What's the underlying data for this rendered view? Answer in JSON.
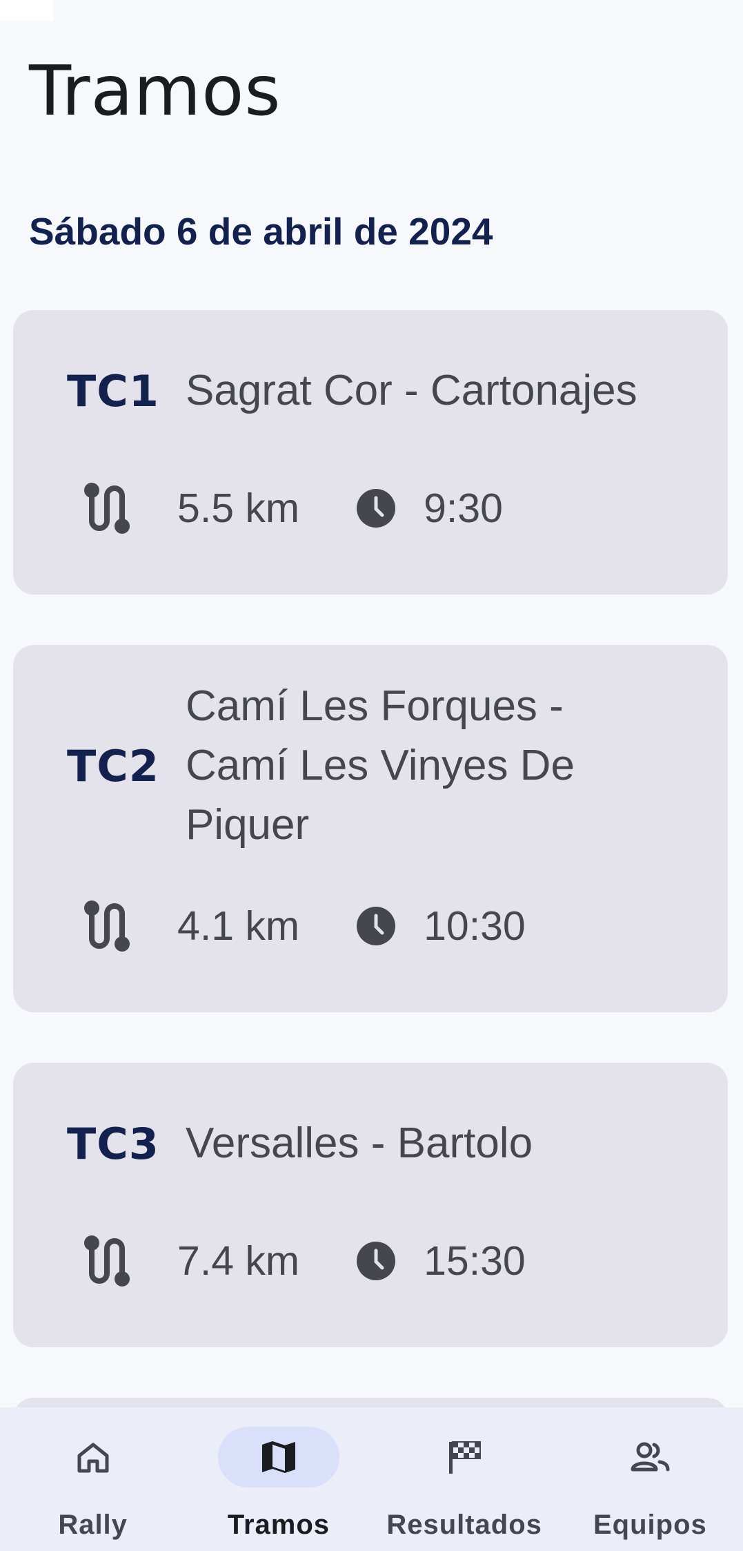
{
  "header": {
    "title": "Tramos",
    "date": "Sábado 6 de abril de 2024"
  },
  "stages": [
    {
      "code": "TC1",
      "name": "Sagrat Cor - Cartonajes",
      "distance": "5.5 km",
      "time": "9:30"
    },
    {
      "code": "TC2",
      "name": "Camí Les Forques - Camí Les Vinyes De Piquer",
      "distance": "4.1 km",
      "time": "10:30"
    },
    {
      "code": "TC3",
      "name": "Versalles - Bartolo",
      "distance": "7.4 km",
      "time": "15:30"
    }
  ],
  "icons": {
    "distance": "route-icon",
    "time": "clock-icon"
  },
  "nav": {
    "items": [
      {
        "label": "Rally",
        "icon": "home-icon",
        "active": false
      },
      {
        "label": "Tramos",
        "icon": "map-icon",
        "active": true
      },
      {
        "label": "Resultados",
        "icon": "checkered-flag-icon",
        "active": false
      },
      {
        "label": "Equipos",
        "icon": "group-icon",
        "active": false
      }
    ]
  },
  "colors": {
    "accent": "#13214f",
    "card_bg": "#e4e2eb",
    "nav_active_pill": "#dbe0fa"
  }
}
